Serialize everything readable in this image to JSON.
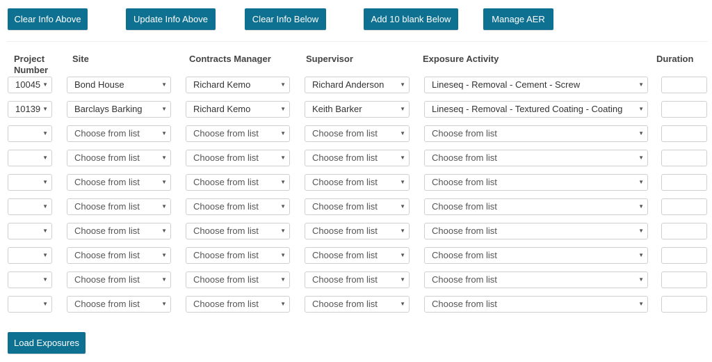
{
  "toolbar": {
    "clear_above": "Clear Info Above",
    "update_above": "Update Info Above",
    "clear_below": "Clear Info Below",
    "add_blank": "Add 10 blank Below",
    "manage_aer": "Manage AER"
  },
  "columns": {
    "project_number": "Project\nNumber",
    "site": "Site",
    "contracts_manager": "Contracts Manager",
    "supervisor": "Supervisor",
    "exposure_activity": "Exposure Activity",
    "duration": "Duration"
  },
  "placeholder": "Choose from list",
  "rows": [
    {
      "project": "10045",
      "site": "Bond House",
      "manager": "Richard Kemo",
      "supervisor": "Richard Anderson",
      "activity": "Lineseq - Removal - Cement - Screw",
      "duration": ""
    },
    {
      "project": "10139",
      "site": "Barclays Barking",
      "manager": "Richard Kemo",
      "supervisor": "Keith Barker",
      "activity": "Lineseq - Removal - Textured Coating - Coating",
      "duration": ""
    },
    {
      "project": "",
      "site": "",
      "manager": "",
      "supervisor": "",
      "activity": "",
      "duration": ""
    },
    {
      "project": "",
      "site": "",
      "manager": "",
      "supervisor": "",
      "activity": "",
      "duration": ""
    },
    {
      "project": "",
      "site": "",
      "manager": "",
      "supervisor": "",
      "activity": "",
      "duration": ""
    },
    {
      "project": "",
      "site": "",
      "manager": "",
      "supervisor": "",
      "activity": "",
      "duration": ""
    },
    {
      "project": "",
      "site": "",
      "manager": "",
      "supervisor": "",
      "activity": "",
      "duration": ""
    },
    {
      "project": "",
      "site": "",
      "manager": "",
      "supervisor": "",
      "activity": "",
      "duration": ""
    },
    {
      "project": "",
      "site": "",
      "manager": "",
      "supervisor": "",
      "activity": "",
      "duration": ""
    },
    {
      "project": "",
      "site": "",
      "manager": "",
      "supervisor": "",
      "activity": "",
      "duration": ""
    }
  ],
  "footer": {
    "load_exposures": "Load Exposures"
  },
  "colors": {
    "button": "#0e7192",
    "button_text": "#ffffff"
  }
}
